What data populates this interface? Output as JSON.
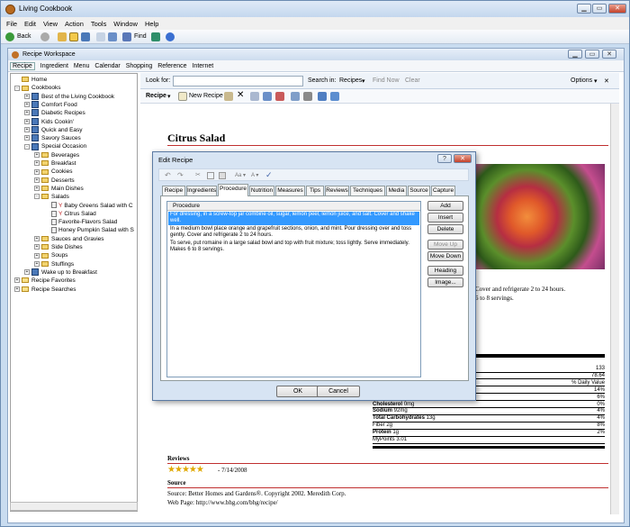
{
  "app": {
    "title": "Living Cookbook"
  },
  "menu": [
    "File",
    "Edit",
    "View",
    "Action",
    "Tools",
    "Window",
    "Help"
  ],
  "toolbar": {
    "back": "Back",
    "find": "Find"
  },
  "workspace": {
    "title": "Recipe Workspace",
    "menu": [
      "Recipe",
      "Ingredient",
      "Menu",
      "Calendar",
      "Shopping",
      "Reference",
      "Internet"
    ]
  },
  "tree": [
    {
      "label": "Home",
      "depth": 1,
      "kind": "home"
    },
    {
      "label": "Cookbooks",
      "depth": 1,
      "kind": "folder",
      "exp": "-"
    },
    {
      "label": "Best of the Living Cookbook",
      "depth": 2,
      "kind": "book",
      "exp": "+"
    },
    {
      "label": "Comfort Food",
      "depth": 2,
      "kind": "book",
      "exp": "+"
    },
    {
      "label": "Diabetic Recipes",
      "depth": 2,
      "kind": "book",
      "exp": "+"
    },
    {
      "label": "Kids Cookin'",
      "depth": 2,
      "kind": "book",
      "exp": "+"
    },
    {
      "label": "Quick and Easy",
      "depth": 2,
      "kind": "book",
      "exp": "+"
    },
    {
      "label": "Savory Sauces",
      "depth": 2,
      "kind": "book",
      "exp": "+"
    },
    {
      "label": "Special Occasion",
      "depth": 2,
      "kind": "book",
      "exp": "-"
    },
    {
      "label": "Beverages",
      "depth": 3,
      "kind": "folder",
      "exp": "+"
    },
    {
      "label": "Breakfast",
      "depth": 3,
      "kind": "folder",
      "exp": "+"
    },
    {
      "label": "Cookies",
      "depth": 3,
      "kind": "folder",
      "exp": "+"
    },
    {
      "label": "Desserts",
      "depth": 3,
      "kind": "folder",
      "exp": "+"
    },
    {
      "label": "Main Dishes",
      "depth": 3,
      "kind": "folder",
      "exp": "+"
    },
    {
      "label": "Salads",
      "depth": 3,
      "kind": "folder",
      "exp": "-"
    },
    {
      "label": "Baby Greens Salad with C",
      "depth": 4,
      "kind": "fav"
    },
    {
      "label": "Citrus Salad",
      "depth": 4,
      "kind": "fav"
    },
    {
      "label": "Favorite-Flavors Salad",
      "depth": 4,
      "kind": "rec"
    },
    {
      "label": "Honey Pumpkin Salad with S",
      "depth": 4,
      "kind": "rec"
    },
    {
      "label": "Sauces and Gravies",
      "depth": 3,
      "kind": "folder",
      "exp": "+"
    },
    {
      "label": "Side Dishes",
      "depth": 3,
      "kind": "folder",
      "exp": "+"
    },
    {
      "label": "Soups",
      "depth": 3,
      "kind": "folder",
      "exp": "+"
    },
    {
      "label": "Stuffings",
      "depth": 3,
      "kind": "folder",
      "exp": "+"
    },
    {
      "label": "Wake up to Breakfast",
      "depth": 2,
      "kind": "book",
      "exp": "+"
    },
    {
      "label": "Recipe Favorites",
      "depth": 1,
      "kind": "fav-folder",
      "exp": "+"
    },
    {
      "label": "Recipe Searches",
      "depth": 1,
      "kind": "search-folder",
      "exp": "+"
    }
  ],
  "lookbar": {
    "look_for": "Look for:",
    "search_in": "Search in:",
    "search_scope": "Recipes",
    "find_now": "Find Now",
    "clear": "Clear",
    "options": "Options"
  },
  "recbar": {
    "recipe": "Recipe",
    "new_recipe": "New Recipe"
  },
  "recipe": {
    "title": "Citrus Salad",
    "proc_frag1": "Cover and refrigerate 2 to 24 hours.",
    "proc_frag2": "6 to 8 servings.",
    "nutrition": [
      {
        "l": "",
        "v": "133",
        "b": false
      },
      {
        "l": "",
        "v": "78.64",
        "b": false
      },
      {
        "l": "",
        "v": "% Daily Value",
        "b": false
      },
      {
        "l": "",
        "v": "14%",
        "b": false
      },
      {
        "l": "",
        "v": "6%",
        "b": false
      },
      {
        "l": "Cholesterol",
        "s": "0mg",
        "v": "0%",
        "b": true
      },
      {
        "l": "Sodium",
        "s": "92mg",
        "v": "4%",
        "b": true
      },
      {
        "l": "Total Carbohydrates",
        "s": "13g",
        "v": "4%",
        "b": true
      },
      {
        "l": "  Fiber",
        "s": "2g",
        "v": "8%",
        "b": false
      },
      {
        "l": "Protein",
        "s": "1g",
        "v": "2%",
        "b": true
      },
      {
        "l": "MyPoints",
        "s": "3.01",
        "v": "",
        "b": false
      }
    ],
    "reviews_heading": "Reviews",
    "review_date": "- 7/14/2008",
    "rating": 5,
    "source_heading": "Source",
    "source_text": "Source: Better Homes and Gardens®. Copyright 2002. Meredith Corp.",
    "web_page": "Web Page: http://www.bhg.com/bhg/recipe/"
  },
  "dialog": {
    "title": "Edit Recipe",
    "tabs": [
      "Recipe",
      "Ingredients",
      "Procedure",
      "Nutrition",
      "Measures",
      "Tips",
      "Reviews",
      "Techniques",
      "Media",
      "Source",
      "Capture"
    ],
    "selected_tab": "Procedure",
    "column": "Procedure",
    "steps": [
      "For dressing, in a screw-top jar combine oil, sugar, lemon peel, lemon juice, and salt. Cover and shake well.",
      "In a medium bowl place orange and grapefruit sections, onion, and mint. Pour dressing over and toss gently. Cover and refrigerate 2 to 24 hours.",
      "To serve, put romaine in a large salad bowl and top with fruit mixture; toss lightly. Serve immediately. Makes 6 to 8 servings."
    ],
    "buttons": {
      "add": "Add",
      "insert": "Insert",
      "delete": "Delete",
      "move_up": "Move Up",
      "move_down": "Move Down",
      "heading": "Heading",
      "image": "Image..."
    },
    "ok": "OK",
    "cancel": "Cancel"
  }
}
